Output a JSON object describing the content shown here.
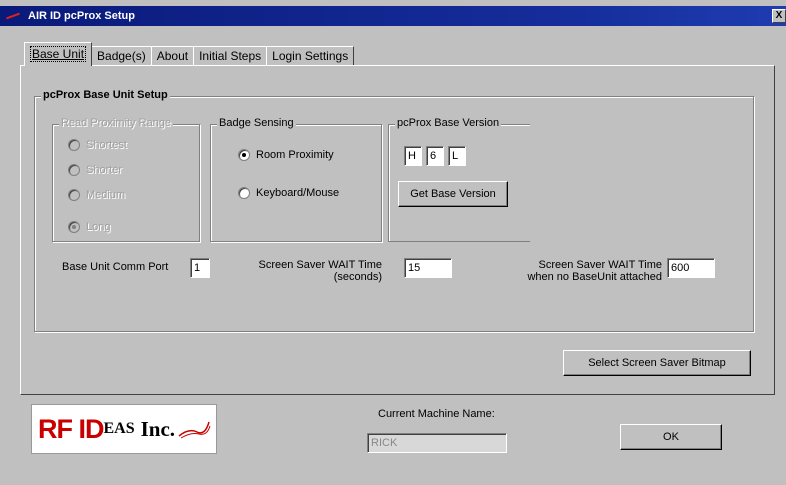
{
  "window": {
    "title": "AIR ID pcProx Setup",
    "close_label": "X"
  },
  "tabs": [
    {
      "label": "Base Unit",
      "active": true
    },
    {
      "label": "Badge(s)"
    },
    {
      "label": "About"
    },
    {
      "label": "Initial Steps"
    },
    {
      "label": "Login Settings"
    }
  ],
  "setup_group": {
    "title": "pcProx Base Unit Setup"
  },
  "range_group": {
    "title": "Read Proximity Range",
    "options": [
      {
        "label": "Shortest",
        "selected": false
      },
      {
        "label": "Shorter",
        "selected": false
      },
      {
        "label": "Medium",
        "selected": false
      },
      {
        "label": "Long",
        "selected": true
      }
    ]
  },
  "badge_group": {
    "title": "Badge Sensing",
    "options": [
      {
        "label": "Room Proximity",
        "selected": true
      },
      {
        "label": "Keyboard/Mouse",
        "selected": false
      }
    ]
  },
  "version_group": {
    "title": "pcProx Base Version",
    "fields": [
      "H",
      "6",
      "L"
    ],
    "button_label": "Get Base Version"
  },
  "comm_port": {
    "label": "Base Unit Comm Port",
    "value": "1"
  },
  "wait_time": {
    "label_line1": "Screen Saver WAIT Time",
    "label_line2": "(seconds)",
    "value": "15"
  },
  "wait_time_nobase": {
    "label_line1": "Screen Saver WAIT Time",
    "label_line2": "when no BaseUnit attached",
    "value": "600"
  },
  "bitmap_button": {
    "label": "Select Screen Saver Bitmap"
  },
  "machine": {
    "label": "Current Machine Name:",
    "value": "RICK"
  },
  "ok_button": {
    "label": "OK"
  },
  "logo": {
    "part1": "RF ID",
    "part2": "EAS",
    "part3": "Inc."
  },
  "colors": {
    "title_bar": "#0a1a7a",
    "logo_red": "#c80000",
    "face": "#c0c0c0"
  }
}
